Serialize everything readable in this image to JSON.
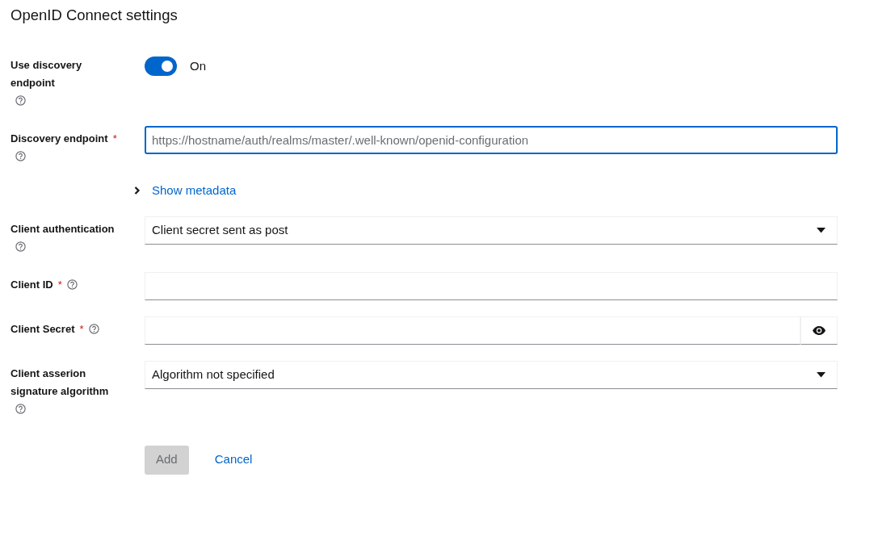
{
  "title": "OpenID Connect settings",
  "fields": [
    {
      "kind": "switch",
      "label": "Use discovery endpoint",
      "help": true,
      "on": true,
      "state_label": "On"
    },
    {
      "kind": "text",
      "label": "Discovery endpoint",
      "required_mark": "*",
      "help": true,
      "placeholder": "https://hostname/auth/realms/master/.well-known/openid-configuration",
      "focused": true
    },
    {
      "kind": "expander",
      "label": "Show metadata",
      "expanded": false
    },
    {
      "kind": "select",
      "label": "Client authentication",
      "help": true,
      "value": "Client secret sent as post"
    },
    {
      "kind": "text",
      "label": "Client ID",
      "required_mark": "*",
      "help": true,
      "focused": false
    },
    {
      "kind": "password",
      "label": "Client Secret",
      "required_mark": "*",
      "help": true
    },
    {
      "kind": "select",
      "label": "Client asserion signature algorithm",
      "help": true,
      "value": "Algorithm not specified"
    }
  ],
  "buttons": [
    {
      "label": "Add",
      "kind": "primary",
      "disabled": true
    },
    {
      "label": "Cancel",
      "kind": "link",
      "disabled": false
    }
  ]
}
